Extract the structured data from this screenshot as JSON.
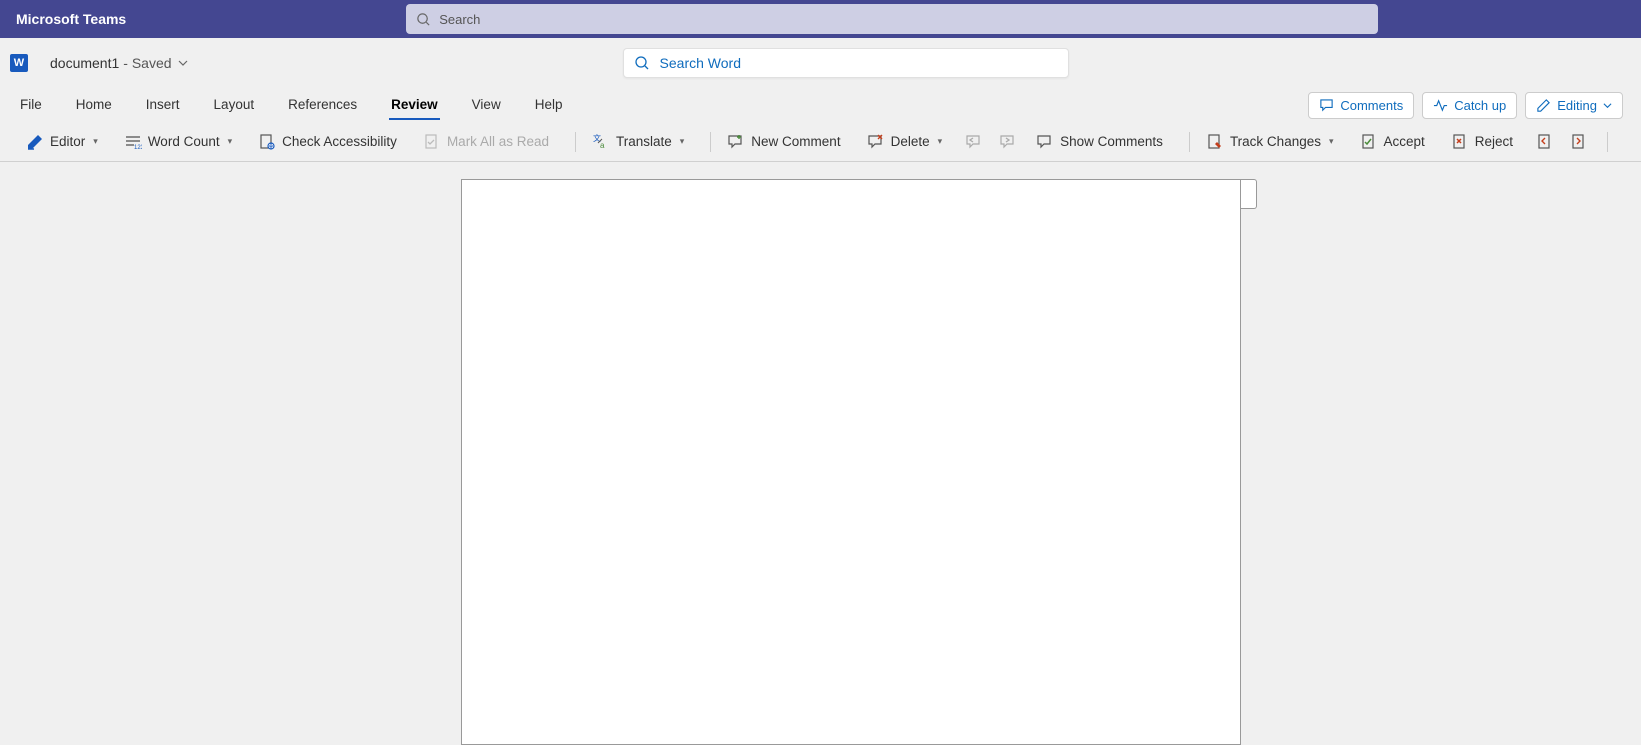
{
  "teams": {
    "title": "Microsoft Teams",
    "search_placeholder": "Search"
  },
  "doc": {
    "name": "document1",
    "status": " -  Saved",
    "word_search_placeholder": "Search Word"
  },
  "tabs": {
    "items": [
      {
        "label": "File"
      },
      {
        "label": "Home"
      },
      {
        "label": "Insert"
      },
      {
        "label": "Layout"
      },
      {
        "label": "References"
      },
      {
        "label": "Review"
      },
      {
        "label": "View"
      },
      {
        "label": "Help"
      }
    ],
    "active": "Review"
  },
  "right_buttons": {
    "comments": "Comments",
    "catchup": "Catch up",
    "editing": "Editing"
  },
  "toolbar": {
    "editor": "Editor",
    "word_count": "Word Count",
    "check_accessibility": "Check Accessibility",
    "mark_all_read": "Mark All as Read",
    "translate": "Translate",
    "new_comment": "New Comment",
    "delete": "Delete",
    "show_comments": "Show Comments",
    "track_changes": "Track Changes",
    "accept": "Accept",
    "reject": "Reject"
  }
}
